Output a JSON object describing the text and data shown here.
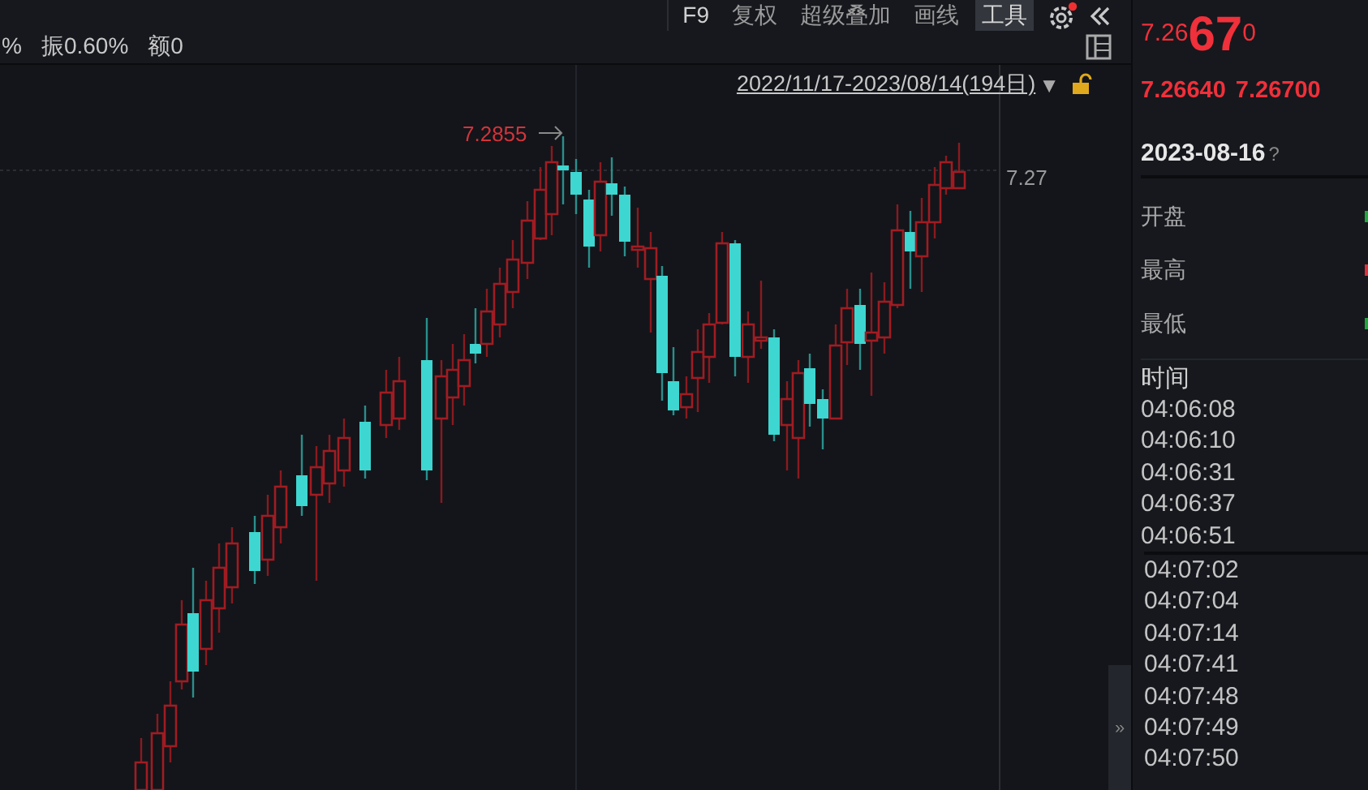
{
  "stats": [
    "%",
    "振0.60%",
    "额0"
  ],
  "toolbar": [
    {
      "label": "F9",
      "selected": false
    },
    {
      "label": "复权",
      "selected": false
    },
    {
      "label": "超级叠加",
      "selected": false
    },
    {
      "label": "画线",
      "selected": false
    },
    {
      "label": "工具",
      "selected": true
    }
  ],
  "settings_notification": true,
  "date_range": {
    "label": "2022/11/17-2023/08/14(194日)",
    "dropdown": "▼",
    "locked": false
  },
  "chart": {
    "high_label": "7.2855",
    "price_label": "7.27"
  },
  "quote": {
    "price_prefix": "7.26",
    "price_main": "67",
    "price_suffix": "0",
    "bid": "7.26640",
    "ask": "7.26700"
  },
  "date": {
    "label": "2023-08-16",
    "help": "?"
  },
  "fields": [
    {
      "label": "开盘",
      "color": "#1fa83c"
    },
    {
      "label": "最高",
      "color": "#e0303a"
    },
    {
      "label": "最低",
      "color": "#1fa83c"
    }
  ],
  "times_header": "时间",
  "time_groups": [
    [
      "04:06:08",
      "04:06:10",
      "04:06:31",
      "04:06:37",
      "04:06:51"
    ],
    [
      "04:07:02",
      "04:07:04",
      "04:07:14",
      "04:07:41",
      "04:07:48",
      "04:07:49",
      "04:07:50"
    ]
  ],
  "collapse_icon": "»"
}
